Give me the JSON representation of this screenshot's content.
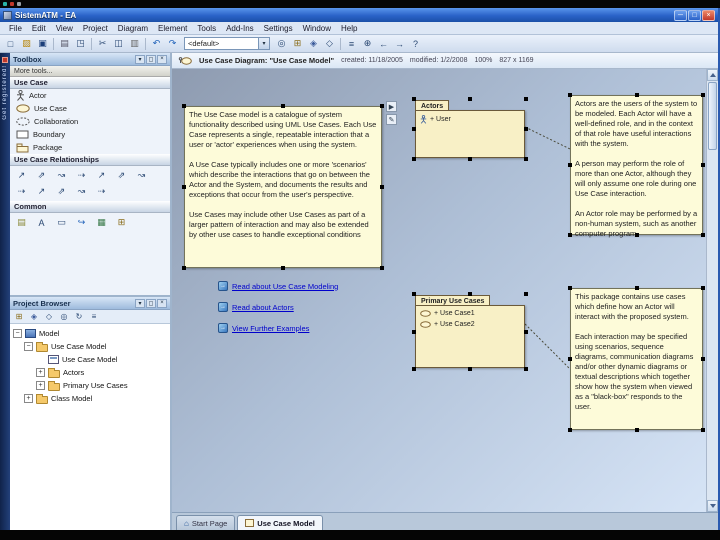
{
  "window": {
    "title": "SistemATM - EA"
  },
  "menu": {
    "items": [
      "File",
      "Edit",
      "View",
      "Project",
      "Diagram",
      "Element",
      "Tools",
      "Add-Ins",
      "Settings",
      "Window",
      "Help"
    ]
  },
  "toolbar": {
    "profile_dropdown_value": "<default>",
    "icons": [
      "new-file-icon",
      "open-icon",
      "save-icon",
      "print-icon",
      "print-preview-icon",
      "cut-icon",
      "copy-icon",
      "paste-icon",
      "undo-icon",
      "redo-icon",
      "search-icon",
      "new-package-icon",
      "new-diagram-icon",
      "new-element-icon",
      "properties-icon",
      "zoom-icon",
      "back-icon",
      "forward-icon",
      "help-icon"
    ]
  },
  "trial_banner": {
    "text": "Get registered!"
  },
  "toolbox": {
    "title": "Toolbox",
    "more_tools_label": "More tools...",
    "use_case_group": {
      "title": "Use Case",
      "items": [
        {
          "label": "Actor"
        },
        {
          "label": "Use Case"
        },
        {
          "label": "Collaboration"
        },
        {
          "label": "Boundary"
        },
        {
          "label": "Package"
        }
      ]
    },
    "relationships_group": {
      "title": "Use Case Relationships",
      "icons": [
        "use-icon",
        "associate-icon",
        "generalize-icon",
        "include-icon",
        "extend-icon",
        "realize-icon",
        "invokes-icon",
        "precedes-icon",
        "dependency-icon",
        "trace-icon",
        "aggregation-icon",
        "note-link-icon"
      ]
    },
    "common_group": {
      "title": "Common",
      "icons": [
        "note-icon",
        "text-icon",
        "document-icon",
        "hyperlink-icon",
        "image-icon",
        "grid-icon"
      ]
    }
  },
  "project_browser": {
    "title": "Project Browser",
    "toolbar_icons": [
      "new-package-icon",
      "new-diagram-icon",
      "new-element-icon",
      "find-icon",
      "refresh-icon",
      "properties-icon"
    ],
    "tree": [
      {
        "label": "Model"
      },
      {
        "label": "Use Case Model"
      },
      {
        "label": "Use Case Model"
      },
      {
        "label": "Actors"
      },
      {
        "label": "Primary Use Cases"
      },
      {
        "label": "Class Model"
      }
    ]
  },
  "diagram": {
    "header": {
      "label": "Use Case Diagram: \"Use Case Model\"",
      "created": "created: 11/18/2005",
      "modified": "modified: 1/2/2008",
      "zoom": "100%",
      "size": "827 x 1169"
    },
    "note_main": {
      "text": "The Use Case model is a catalogue of system functionality described using UML Use Cases. Each Use Case represents a single, repeatable interaction that a user or 'actor' experiences when using the system.\n\nA Use Case typically includes one or more 'scenarios' which describe the interactions that go on between the Actor and the System, and documents the results and exceptions that occur from the user's perspective.\n\nUse Cases may include other Use Cases as part of a larger pattern of interaction and may also be extended by other use cases to handle exceptional conditions"
    },
    "actors_package": {
      "name": "Actors",
      "items": [
        {
          "label": "+ User"
        }
      ]
    },
    "note_actors": {
      "text": "Actors are the users of the system to be modeled. Each Actor will have a well-defined role, and in the context of that role have useful interactions with the system.\n\nA person may perform the role of more than one Actor, although they will only assume one role during one Use Case interaction.\n\nAn Actor role may be performed by a non-human system, such as another computer program."
    },
    "links": [
      {
        "label": "Read about Use Case Modeling"
      },
      {
        "label": "Read about Actors"
      },
      {
        "label": "View Further Examples"
      }
    ],
    "primary_package": {
      "name": "Primary Use Cases",
      "items": [
        {
          "label": "+ Use Case1"
        },
        {
          "label": "+ Use Case2"
        }
      ]
    },
    "note_primary": {
      "text": "This package contains use cases which define how an Actor will interact with the proposed system.\n\nEach interaction may be specified using scenarios, sequence diagrams, communication diagrams and/or other dynamic diagrams or textual descriptions which together show how the system when viewed as a \"black-box\" responds to the user."
    },
    "tabs": [
      {
        "label": "Start Page"
      },
      {
        "label": "Use Case Model"
      }
    ]
  },
  "colors": {
    "titlebar_blue": "#2a62c8",
    "note_fill": "#fdfbd9",
    "package_fill": "#f8f0c6",
    "link_blue": "#0000cc",
    "canvas_top": "#8e9bb0",
    "canvas_bottom": "#d6e4f6",
    "selection_handle": "#000000"
  }
}
